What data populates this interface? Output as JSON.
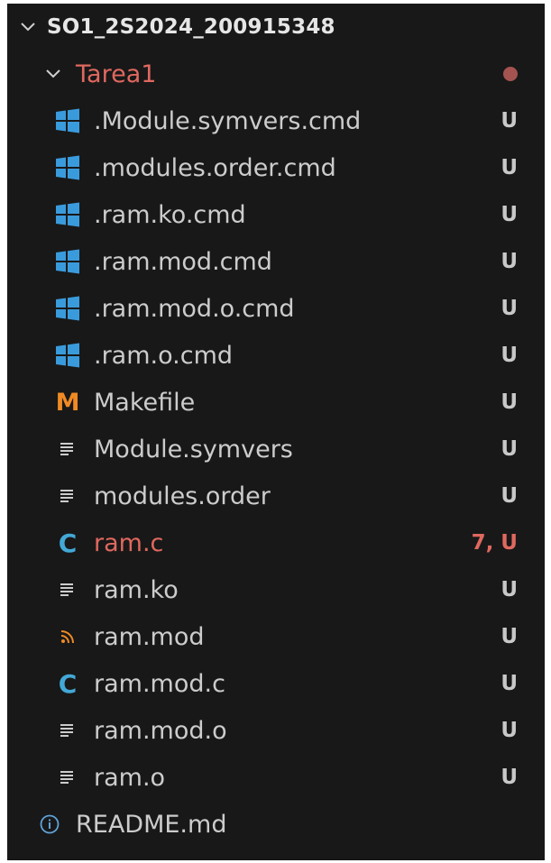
{
  "explorer": {
    "root": {
      "label": "SO1_2S2024_200915348"
    },
    "folder": {
      "label": "Tarea1"
    },
    "files": [
      {
        "name": ".Module.symvers.cmd",
        "icon": "windows-icon",
        "status": "U",
        "modified": false
      },
      {
        "name": ".modules.order.cmd",
        "icon": "windows-icon",
        "status": "U",
        "modified": false
      },
      {
        "name": ".ram.ko.cmd",
        "icon": "windows-icon",
        "status": "U",
        "modified": false
      },
      {
        "name": ".ram.mod.cmd",
        "icon": "windows-icon",
        "status": "U",
        "modified": false
      },
      {
        "name": ".ram.mod.o.cmd",
        "icon": "windows-icon",
        "status": "U",
        "modified": false
      },
      {
        "name": ".ram.o.cmd",
        "icon": "windows-icon",
        "status": "U",
        "modified": false
      },
      {
        "name": "Makefile",
        "icon": "makefile-icon",
        "status": "U",
        "modified": false
      },
      {
        "name": "Module.symvers",
        "icon": "text-file-icon",
        "status": "U",
        "modified": false
      },
      {
        "name": "modules.order",
        "icon": "text-file-icon",
        "status": "U",
        "modified": false
      },
      {
        "name": "ram.c",
        "icon": "c-file-icon",
        "status": "7, U",
        "modified": true
      },
      {
        "name": "ram.ko",
        "icon": "text-file-icon",
        "status": "U",
        "modified": false
      },
      {
        "name": "ram.mod",
        "icon": "rss-icon",
        "status": "U",
        "modified": false
      },
      {
        "name": "ram.mod.c",
        "icon": "c-file-icon",
        "status": "U",
        "modified": false
      },
      {
        "name": "ram.mod.o",
        "icon": "text-file-icon",
        "status": "U",
        "modified": false
      },
      {
        "name": "ram.o",
        "icon": "text-file-icon",
        "status": "U",
        "modified": false
      }
    ],
    "readme": {
      "name": "README.md",
      "icon": "info-icon"
    }
  },
  "colors": {
    "background": "#181818",
    "text": "#cccccc",
    "modified": "#e0685f",
    "windows_icon": "#3a9bdc",
    "makefile_icon": "#f08a24",
    "c_icon": "#43a8d6",
    "rss_icon": "#f08a24",
    "info_icon": "#5fa3d8"
  }
}
